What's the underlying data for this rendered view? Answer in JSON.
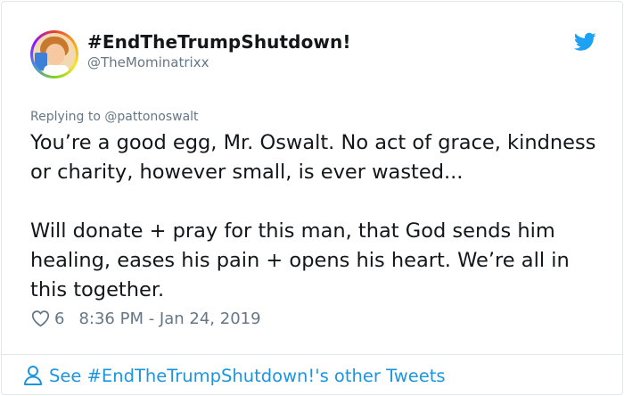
{
  "author": {
    "display_name": "#EndTheTrumpShutdown!",
    "handle": "@TheMominatrixx"
  },
  "tweet": {
    "reply_prefix": "Replying to @pattonoswalt",
    "text": "You’re a good egg, Mr. Oswalt. No act of grace, kindness or charity, however small, is ever wasted...\n\nWill donate + pray for this man, that God sends him healing, eases his pain + opens his heart. We’re all in this together.",
    "likes": "6",
    "timestamp": "8:36 PM - Jan 24, 2019"
  },
  "footer": {
    "link_text": "See #EndTheTrumpShutdown!'s other Tweets"
  },
  "colors": {
    "accent": "#1b95e0",
    "twitter_blue": "#1da1f2",
    "muted": "#657786",
    "text": "#14171a",
    "border": "#e1e8ed"
  },
  "icons": {
    "brand": "twitter-bird-icon",
    "like": "heart-icon",
    "profile": "person-icon"
  }
}
